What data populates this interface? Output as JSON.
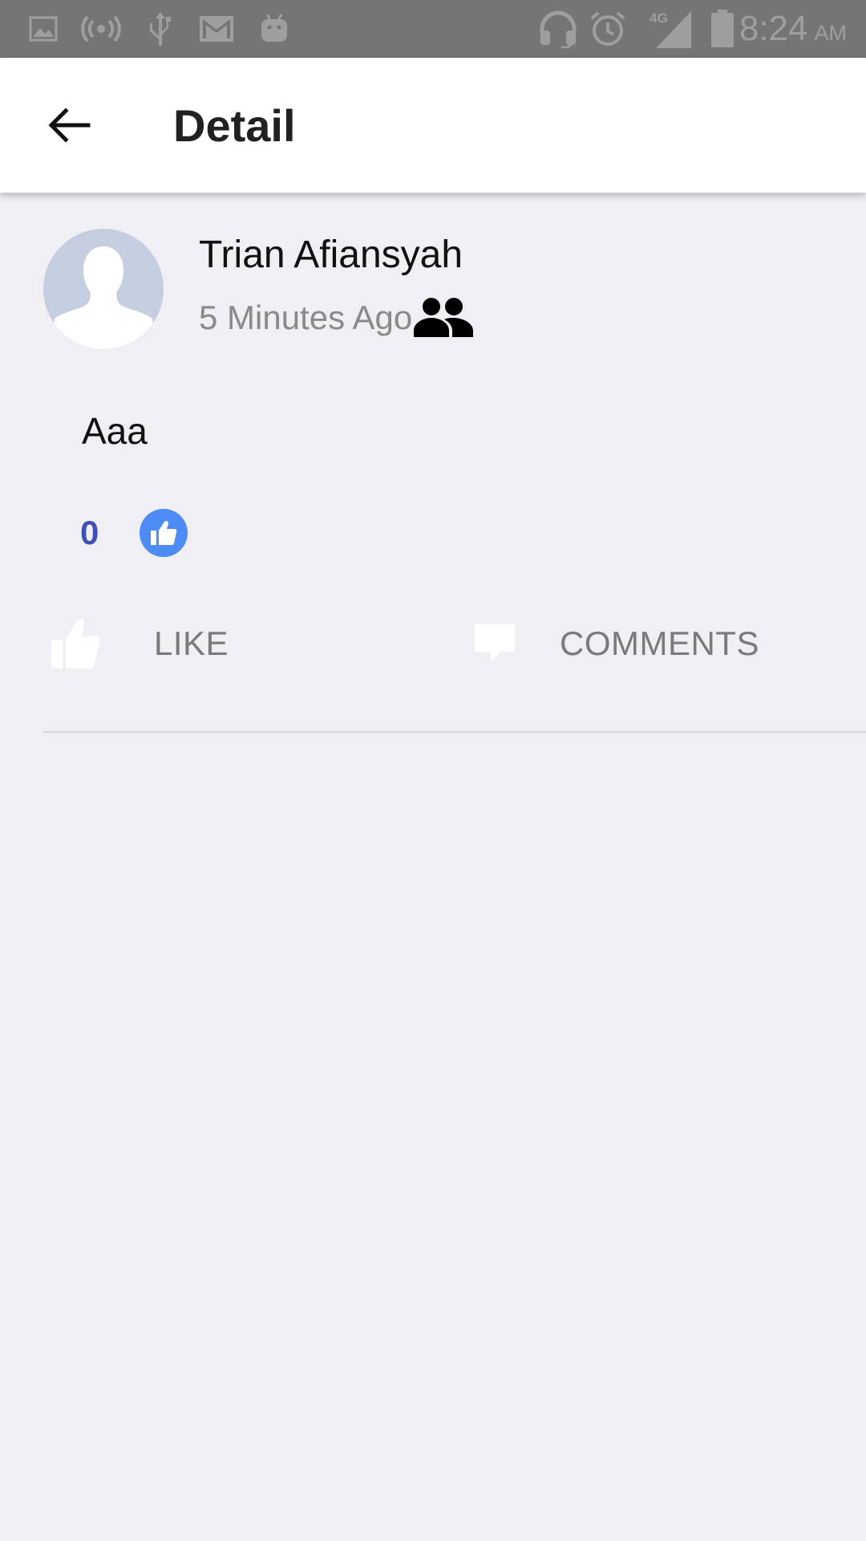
{
  "status_bar": {
    "time": "8:24",
    "ampm": "AM",
    "network_label": "4G",
    "icons": [
      "image-icon",
      "hotspot-icon",
      "usb-icon",
      "gmail-icon",
      "android-icon",
      "headset-icon",
      "alarm-icon",
      "signal-icon",
      "battery-icon"
    ]
  },
  "app_bar": {
    "title": "Detail"
  },
  "post": {
    "author": "Trian Afiansyah",
    "timestamp": "5 Minutes Ago",
    "body": "Aaa",
    "like_count": "0"
  },
  "actions": {
    "like_label": "LIKE",
    "comments_label": "COMMENTS"
  },
  "colors": {
    "background": "#EFEFF4",
    "status_bar": "#757575",
    "accent": "#3F51B5",
    "reaction_blue": "#4D8BF5",
    "avatar_bg": "#C5CEE0"
  }
}
